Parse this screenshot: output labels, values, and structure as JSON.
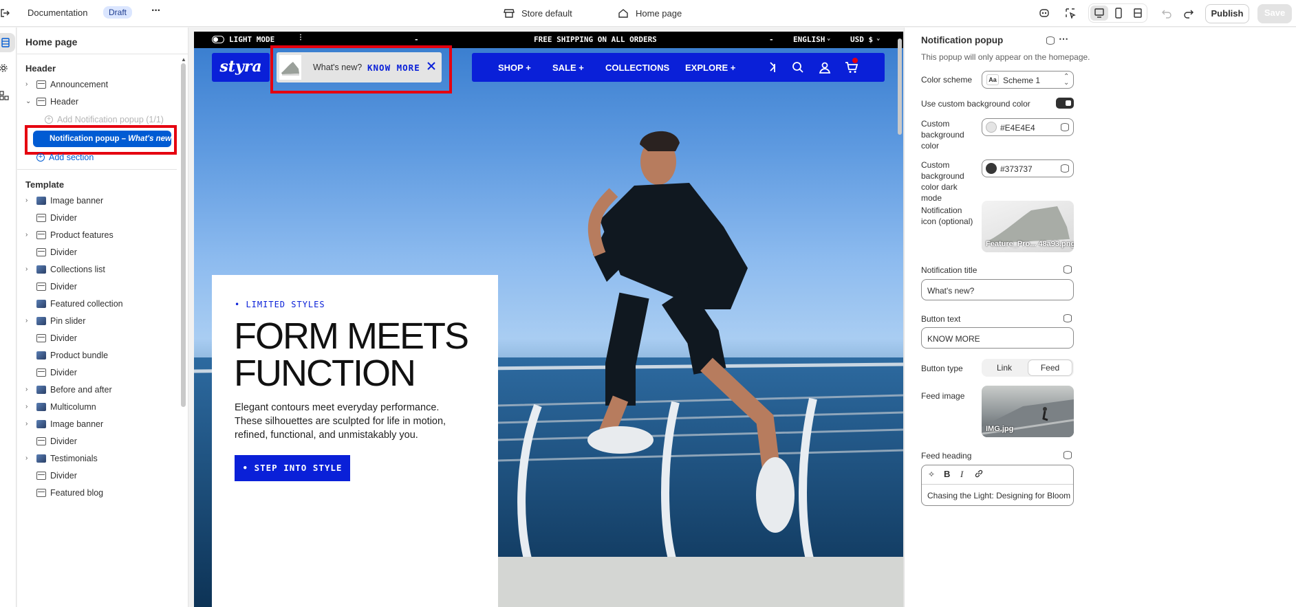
{
  "topbar": {
    "documentation": "Documentation",
    "draft_badge": "Draft",
    "more": "···",
    "store_label": "Store default",
    "page_label": "Home page",
    "publish": "Publish",
    "save": "Save"
  },
  "left_panel": {
    "title": "Home page",
    "header_group": "Header",
    "header_items": [
      {
        "label": "Announcement"
      },
      {
        "label": "Header"
      }
    ],
    "add_notification": "Add Notification popup (1/1)",
    "notification_item": "Notification popup",
    "notification_sub": "– What's new?",
    "add_section": "Add section",
    "template_group": "Template",
    "template_items": [
      {
        "label": "Image banner",
        "chevron": true
      },
      {
        "label": "Divider",
        "chevron": false
      },
      {
        "label": "Product features",
        "chevron": true
      },
      {
        "label": "Divider",
        "chevron": false
      },
      {
        "label": "Collections list",
        "chevron": true
      },
      {
        "label": "Divider",
        "chevron": false
      },
      {
        "label": "Featured collection",
        "chevron": false
      },
      {
        "label": "Pin slider",
        "chevron": true
      },
      {
        "label": "Divider",
        "chevron": false
      },
      {
        "label": "Product bundle",
        "chevron": false
      },
      {
        "label": "Divider",
        "chevron": false
      },
      {
        "label": "Before and after",
        "chevron": true
      },
      {
        "label": "Multicolumn",
        "chevron": true
      },
      {
        "label": "Image banner",
        "chevron": true
      },
      {
        "label": "Divider",
        "chevron": false
      },
      {
        "label": "Testimonials",
        "chevron": true
      },
      {
        "label": "Divider",
        "chevron": false
      },
      {
        "label": "Featured blog",
        "chevron": false
      }
    ]
  },
  "store": {
    "light_mode": "LIGHT MODE",
    "announcement": "FREE SHIPPING ON ALL ORDERS",
    "language": "ENGLISH",
    "currency": "USD $",
    "logo": "styra",
    "popup_title": "What's new?",
    "popup_button": "KNOW MORE",
    "nav": [
      "SHOP +",
      "SALE +",
      "COLLECTIONS",
      "EXPLORE +"
    ],
    "hero": {
      "eyebrow": "LIMITED STYLES",
      "heading_line1": "FORM MEETS",
      "heading_line2": "FUNCTION",
      "body": "Elegant contours meet everyday performance. These silhouettes are sculpted for life in motion, refined, functional, and unmistakably you.",
      "cta": "STEP INTO STYLE"
    }
  },
  "right_panel": {
    "title": "Notification popup",
    "description": "This popup will only appear on the homepage.",
    "color_scheme_label": "Color scheme",
    "color_scheme_value": "Scheme 1",
    "custom_bg_label": "Use custom background color",
    "custom_bg_enabled": true,
    "custom_bg_color_label": "Custom background color",
    "custom_bg_color_value": "#E4E4E4",
    "custom_bg_dark_label": "Custom background color dark mode",
    "custom_bg_dark_value": "#373737",
    "notification_icon_label": "Notification icon (optional)",
    "notification_icon_file": "Feature_Pro... 48a93.png",
    "notification_title_label": "Notification title",
    "notification_title_value": "What's new?",
    "button_text_label": "Button text",
    "button_text_value": "KNOW MORE",
    "button_type_label": "Button type",
    "button_type_options": [
      "Link",
      "Feed"
    ],
    "button_type_selected": "Feed",
    "feed_image_label": "Feed image",
    "feed_image_file": "IMG.jpg",
    "feed_heading_label": "Feed heading",
    "feed_heading_value": "Chasing the Light: Designing for Bloom"
  },
  "colors": {
    "accent_blue": "#0a20d8",
    "editor_selected": "#005bd3",
    "highlight_red": "#e5000f"
  }
}
